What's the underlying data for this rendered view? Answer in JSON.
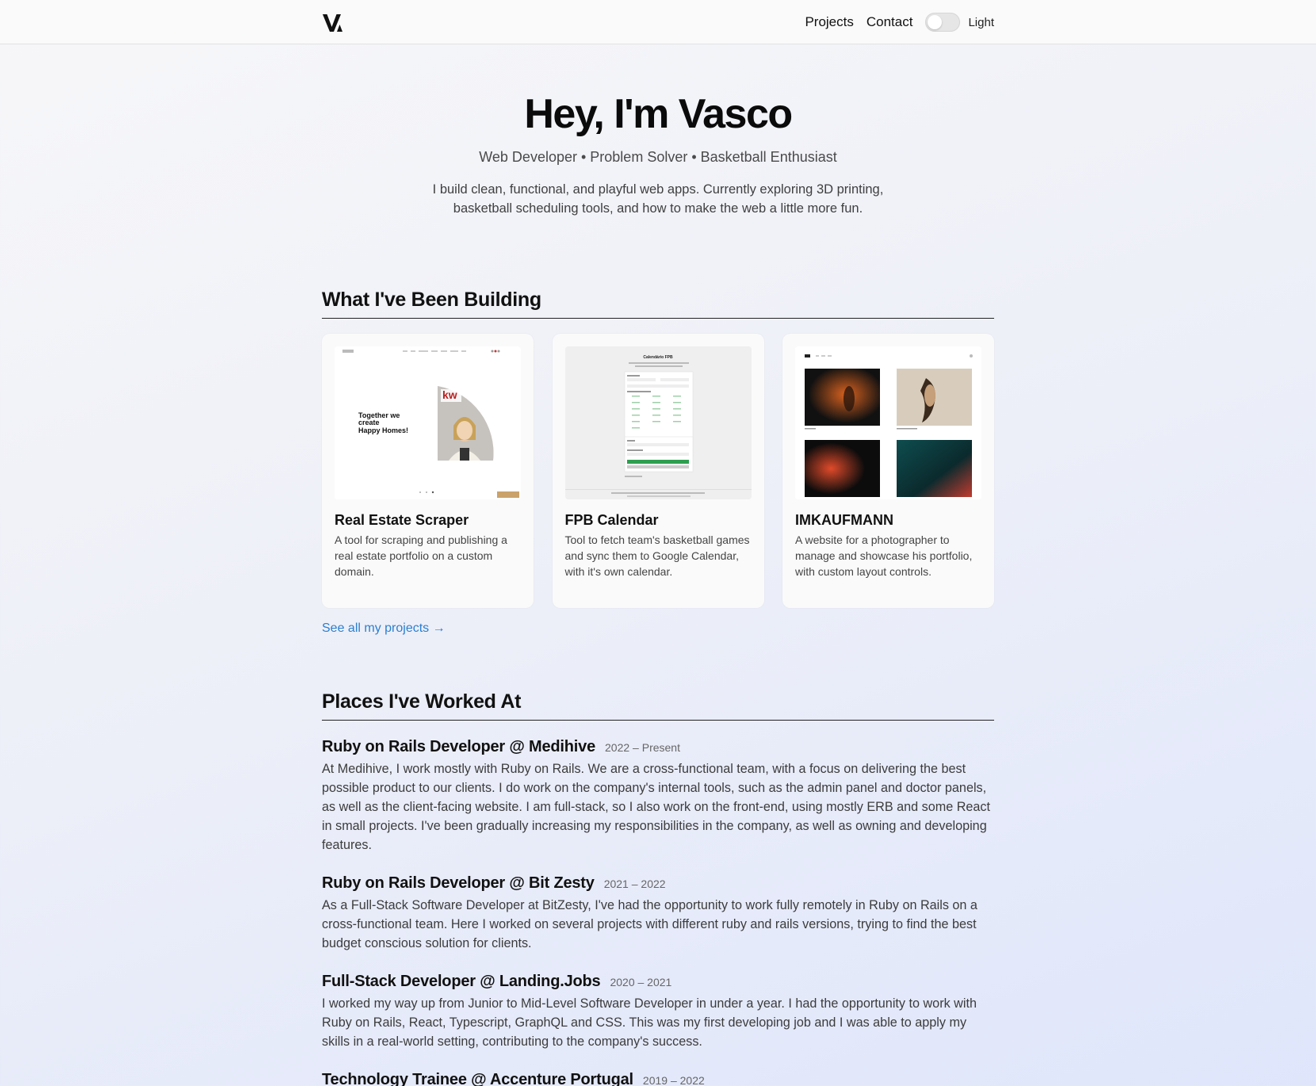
{
  "header": {
    "logo_alt": "V",
    "nav": [
      {
        "label": "Projects"
      },
      {
        "label": "Contact"
      }
    ],
    "theme_toggle": {
      "label": "Light",
      "on": false
    }
  },
  "hero": {
    "title": "Hey, I'm Vasco",
    "tagline": "Web Developer • Problem Solver • Basketball Enthusiast",
    "intro": "I build clean, functional, and playful web apps. Currently exploring 3D printing, basketball scheduling tools, and how to make the web a little more fun."
  },
  "projects": {
    "section_title": "What I've Been Building",
    "items": [
      {
        "title": "Real Estate Scraper",
        "description": "A tool for scraping and publishing a real estate portfolio on a custom domain.",
        "thumb_text": "Together we create Happy Homes!",
        "thumb_brand": "kw"
      },
      {
        "title": "FPB Calendar",
        "description": "Tool to fetch team's basketball games and sync them to Google Calendar, with it's own calendar.",
        "thumb_text": "Calendário FPB"
      },
      {
        "title": "IMKAUFMANN",
        "description": "A website for a photographer to manage and showcase his portfolio, with custom layout controls."
      }
    ],
    "see_all": "See all my projects →"
  },
  "work": {
    "section_title": "Places I've Worked At",
    "jobs": [
      {
        "title": "Ruby on Rails Developer @ Medihive",
        "years": "2022 – Present",
        "description": "At Medihive, I work mostly with Ruby on Rails. We are a cross-functional team, with a focus on delivering the best possible product to our clients. I do work on the company's internal tools, such as the admin panel and doctor panels, as well as the client-facing website. I am full-stack, so I also work on the front-end, using mostly ERB and some React in small projects. I've been gradually increasing my responsibilities in the company, as well as owning and developing features."
      },
      {
        "title": "Ruby on Rails Developer @ Bit Zesty",
        "years": "2021 – 2022",
        "description": "As a Full-Stack Software Developer at BitZesty, I've had the opportunity to work fully remotely in Ruby on Rails on a cross-functional team. Here I worked on several projects with different ruby and rails versions, trying to find the best budget conscious solution for clients."
      },
      {
        "title": "Full-Stack Developer @ Landing.Jobs",
        "years": "2020 – 2021",
        "description": "I worked my way up from Junior to Mid-Level Software Developer in under a year. I had the opportunity to work with Ruby on Rails, React, Typescript, GraphQL and CSS. This was my first developing job and I was able to apply my skills in a real-world setting, contributing to the company's success."
      },
      {
        "title": "Technology Trainee @ Accenture Portugal",
        "years": "2019 – 2022",
        "description": ""
      }
    ]
  },
  "colors": {
    "accent_link": "#2b7fd0",
    "text": "#111111",
    "card_bg": "#fafafa"
  }
}
